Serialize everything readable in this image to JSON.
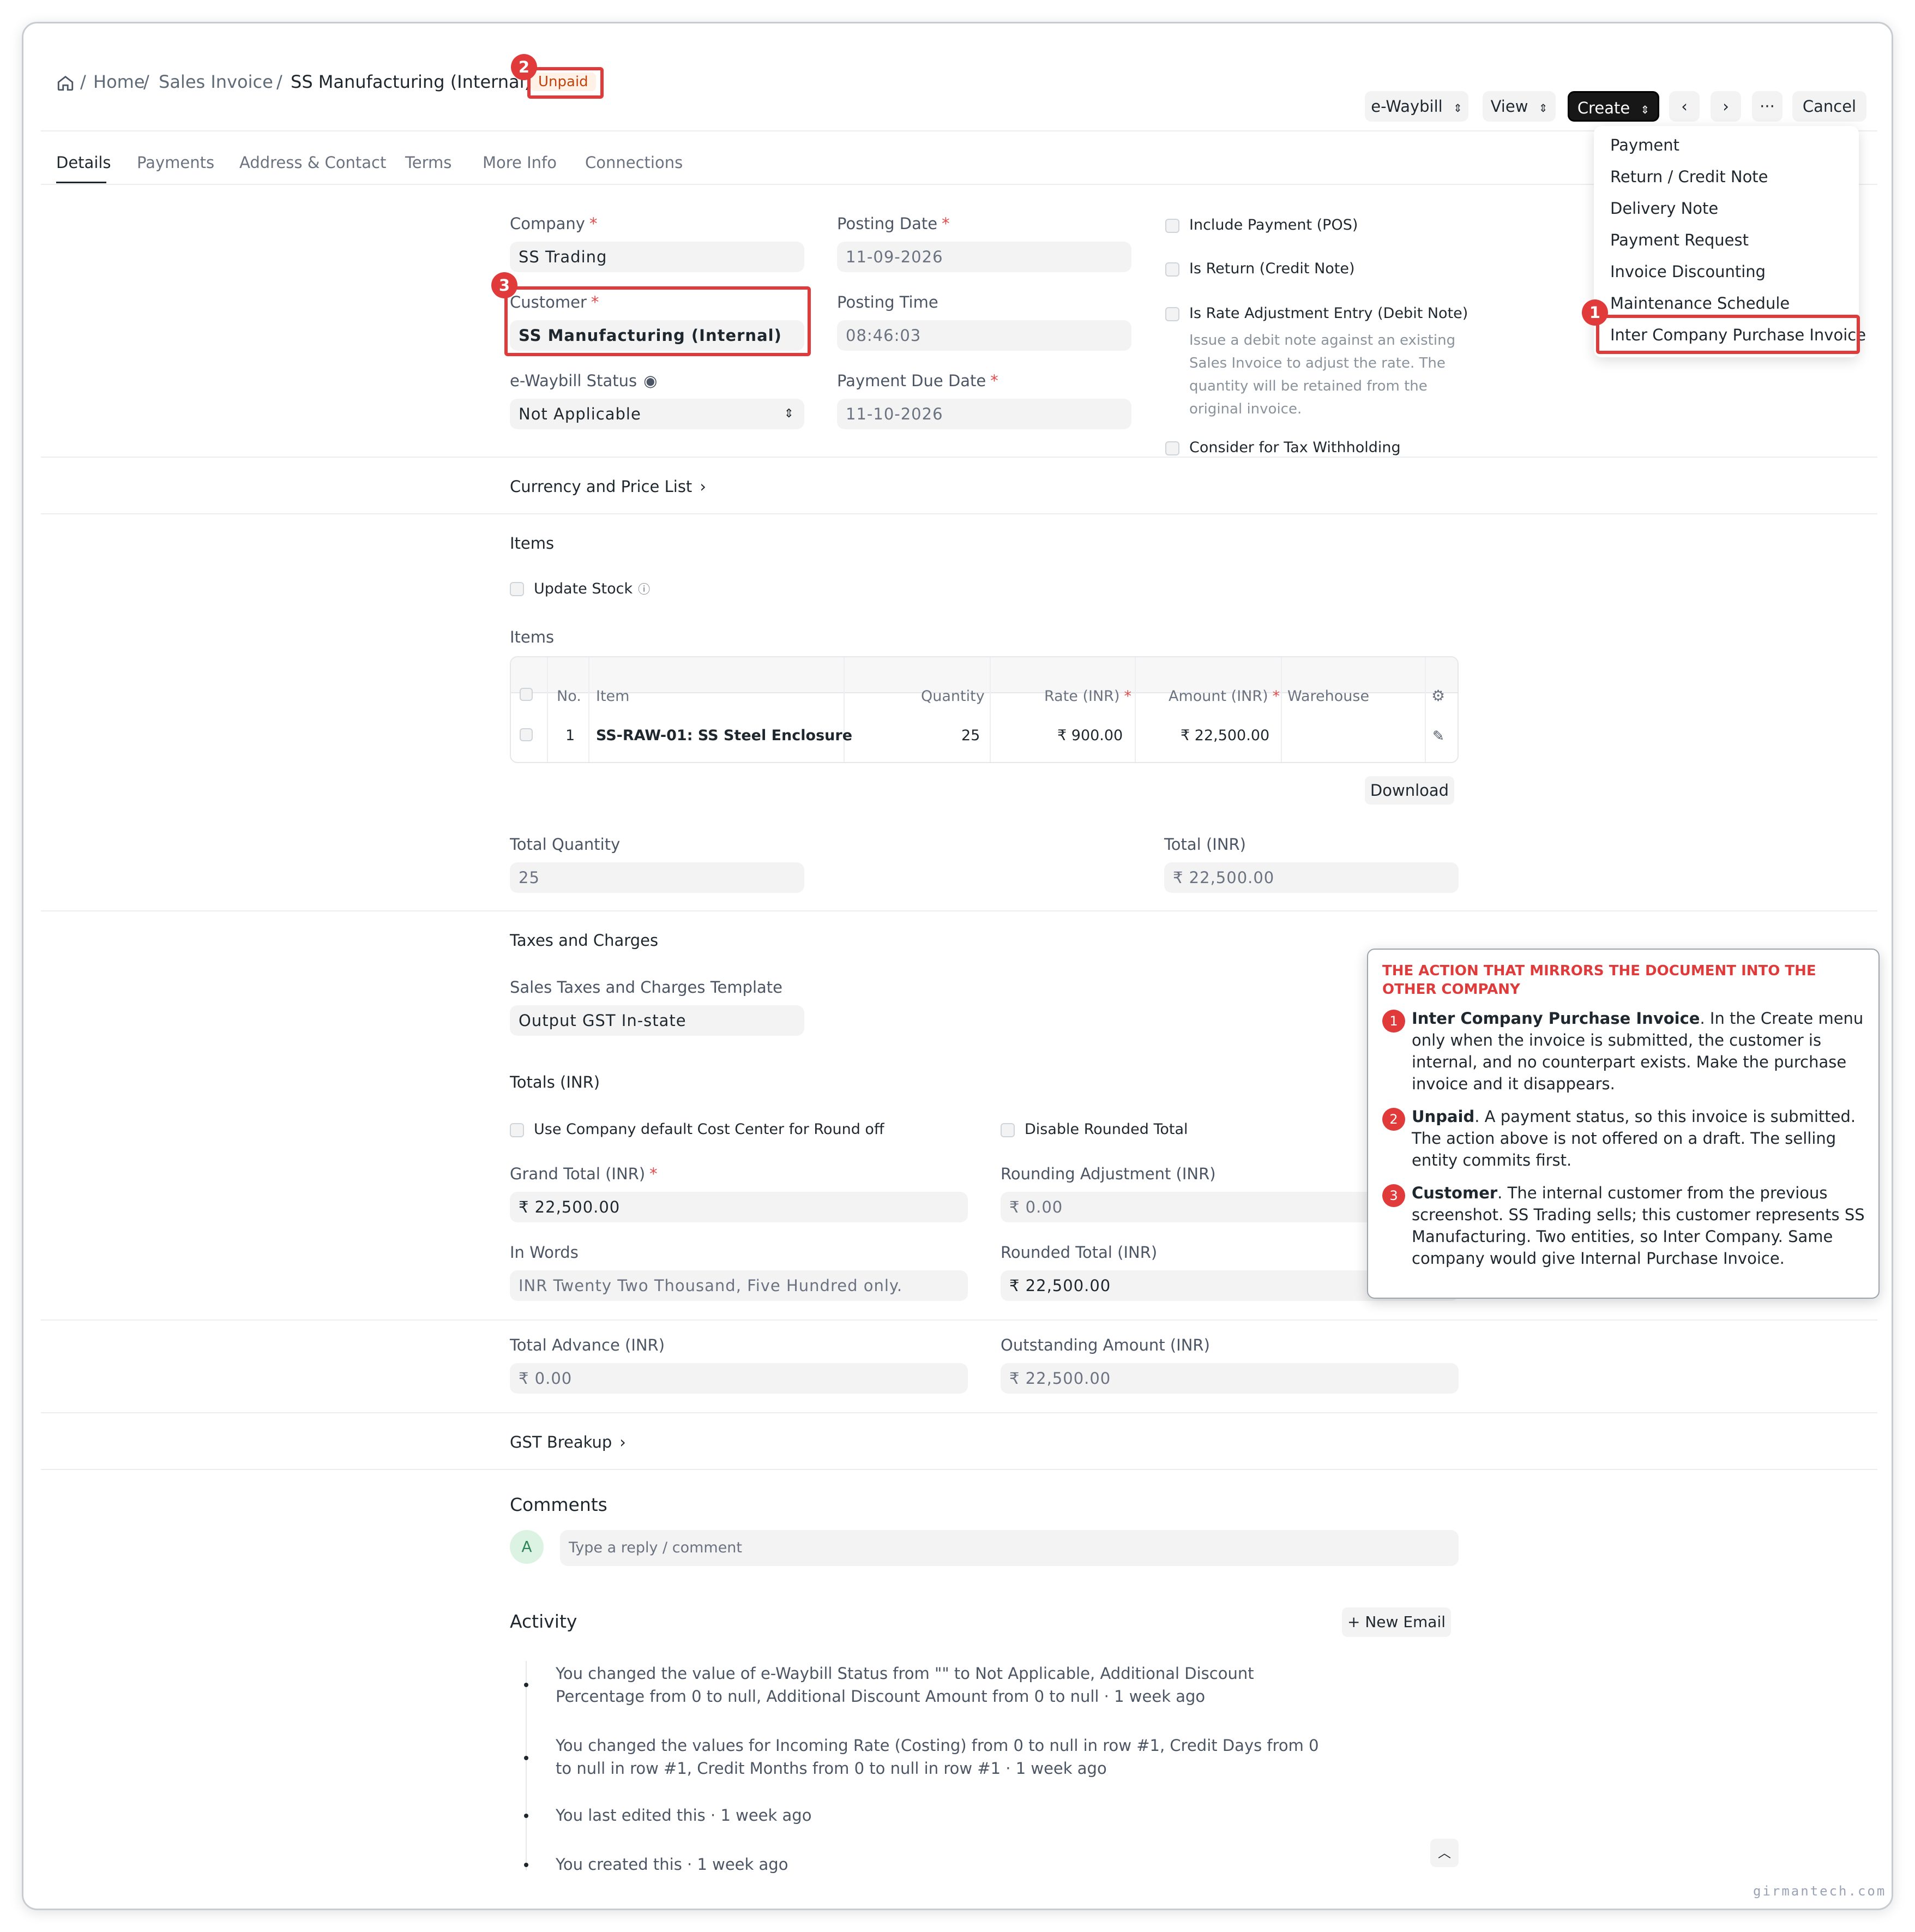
{
  "breadcrumb": {
    "home": "Home",
    "doctype": "Sales Invoice",
    "doc": "SS Manufacturing (Internal)",
    "status": "Unpaid",
    "sep": "/"
  },
  "toolbar": {
    "ewaybill": "e-Waybill",
    "view": "View",
    "create": "Create",
    "more": "···",
    "cancel": "Cancel"
  },
  "create_menu": [
    "Payment",
    "Return / Credit Note",
    "Delivery Note",
    "Payment Request",
    "Invoice Discounting",
    "Maintenance Schedule",
    "Inter Company Purchase Invoice"
  ],
  "tabs": [
    "Details",
    "Payments",
    "Address & Contact",
    "Terms",
    "More Info",
    "Connections"
  ],
  "form": {
    "company_label": "Company",
    "company": "SS Trading",
    "posting_date_label": "Posting Date",
    "posting_date": "11-09-2026",
    "customer_label": "Customer",
    "customer": "SS Manufacturing (Internal)",
    "posting_time_label": "Posting Time",
    "posting_time": "08:46:03",
    "ewaybill_status_label": "e-Waybill Status",
    "ewaybill_status": "Not Applicable",
    "payment_due_label": "Payment Due Date",
    "payment_due": "11-10-2026",
    "include_payment": "Include Payment (POS)",
    "is_return": "Is Return (Credit Note)",
    "is_rate_adj": "Is Rate Adjustment Entry (Debit Note)",
    "rate_adj_help": "Issue a debit note against an existing Sales Invoice to adjust the rate. The quantity will be retained from the original invoice.",
    "tax_withholding": "Consider for Tax Withholding"
  },
  "currency_section": "Currency and Price List",
  "items_section": {
    "title": "Items",
    "update_stock": "Update Stock",
    "table_label": "Items",
    "headers": [
      "No.",
      "Item",
      "Quantity",
      "Rate (INR)",
      "Amount (INR)",
      "Warehouse"
    ],
    "rows": [
      {
        "no": "1",
        "item": "SS-RAW-01: SS Steel Enclosure",
        "qty": "25",
        "rate": "₹ 900.00",
        "amount": "₹ 22,500.00",
        "warehouse": ""
      }
    ],
    "download": "Download",
    "total_qty_label": "Total Quantity",
    "total_qty": "25",
    "total_label": "Total (INR)",
    "total": "₹ 22,500.00"
  },
  "taxes": {
    "title": "Taxes and Charges",
    "template_label": "Sales Taxes and Charges Template",
    "template": "Output GST In-state"
  },
  "totals": {
    "title": "Totals (INR)",
    "cost_center": "Use Company default Cost Center for Round off",
    "disable_rounded": "Disable Rounded Total",
    "grand_total_label": "Grand Total (INR)",
    "grand_total": "₹ 22,500.00",
    "rounding_adj_label": "Rounding Adjustment (INR)",
    "rounding_adj": "₹ 0.00",
    "in_words_label": "In Words",
    "in_words": "INR Twenty Two Thousand, Five Hundred only.",
    "rounded_total_label": "Rounded Total (INR)",
    "rounded_total": "₹ 22,500.00",
    "advance_label": "Total Advance (INR)",
    "advance": "₹ 0.00",
    "outstanding_label": "Outstanding Amount (INR)",
    "outstanding": "₹ 22,500.00"
  },
  "gst_breakup": "GST Breakup",
  "comments": {
    "title": "Comments",
    "avatar": "A",
    "placeholder": "Type a reply / comment"
  },
  "activity": {
    "title": "Activity",
    "new_email": "+ New Email",
    "items": [
      "You changed the value of e-Waybill Status from \"\" to Not Applicable, Additional Discount Percentage from 0 to null, Additional Discount Amount from 0 to null · 1 week ago",
      "You changed the values for Incoming Rate (Costing) from 0 to null in row #1, Credit Days from 0 to null in row #1, Credit Months from 0 to null in row #1 · 1 week ago",
      "You last edited this · 1 week ago",
      "You created this · 1 week ago"
    ]
  },
  "callout": {
    "heading": "THE ACTION THAT MIRRORS THE DOCUMENT INTO THE OTHER COMPANY",
    "notes": [
      {
        "num": "1",
        "title": "Inter Company Purchase Invoice",
        "text": ". In the Create menu only when the invoice is submitted, the customer is internal, and no counterpart exists. Make the purchase invoice and it disappears."
      },
      {
        "num": "2",
        "title": "Unpaid",
        "text": ". A payment status, so this invoice is submitted. The action above is not offered on a draft. The selling entity commits first."
      },
      {
        "num": "3",
        "title": "Customer",
        "text": ". The internal customer from the previous screenshot. SS Trading sells; this customer represents SS Manufacturing. Two entities, so Inter Company. Same company would give Internal Purchase Invoice."
      }
    ]
  },
  "annotation_badges": [
    "1",
    "2",
    "3"
  ],
  "watermark": "girmantech.com",
  "colors": {
    "accent_red": "#e03a3a",
    "primary_dark": "#171717",
    "field_bg": "#f3f3f3"
  }
}
